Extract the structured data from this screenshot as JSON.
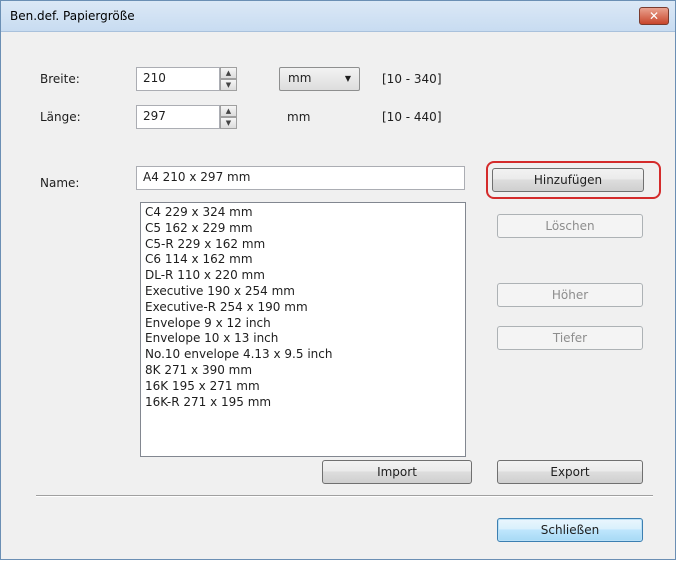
{
  "window": {
    "title": "Ben.def. Papiergröße",
    "close_label": "✕"
  },
  "width_row": {
    "label": "Breite:",
    "value": "210",
    "unit_selected": "mm",
    "range": "[10 - 340]"
  },
  "length_row": {
    "label": "Länge:",
    "value": "297",
    "unit": "mm",
    "range": "[10 - 440]"
  },
  "name_row": {
    "label": "Name:",
    "value": "A4 210 x 297 mm"
  },
  "paper_list": {
    "items": [
      "C4 229 x 324 mm",
      "C5 162 x 229 mm",
      "C5-R 229 x 162 mm",
      "C6 114 x 162 mm",
      "DL-R 110 x 220 mm",
      "Executive 190 x 254 mm",
      "Executive-R 254 x 190 mm",
      "Envelope 9 x 12 inch",
      "Envelope 10 x 13 inch",
      "No.10 envelope 4.13 x 9.5 inch",
      "8K 271 x 390 mm",
      "16K 195 x 271 mm",
      "16K-R 271 x 195 mm"
    ]
  },
  "buttons": {
    "add": "Hinzufügen",
    "delete": "Löschen",
    "up": "Höher",
    "down": "Tiefer",
    "import": "Import",
    "export": "Export",
    "close": "Schließen"
  },
  "colors": {
    "highlight": "#d42b2b",
    "close_button": "#c8462c"
  }
}
